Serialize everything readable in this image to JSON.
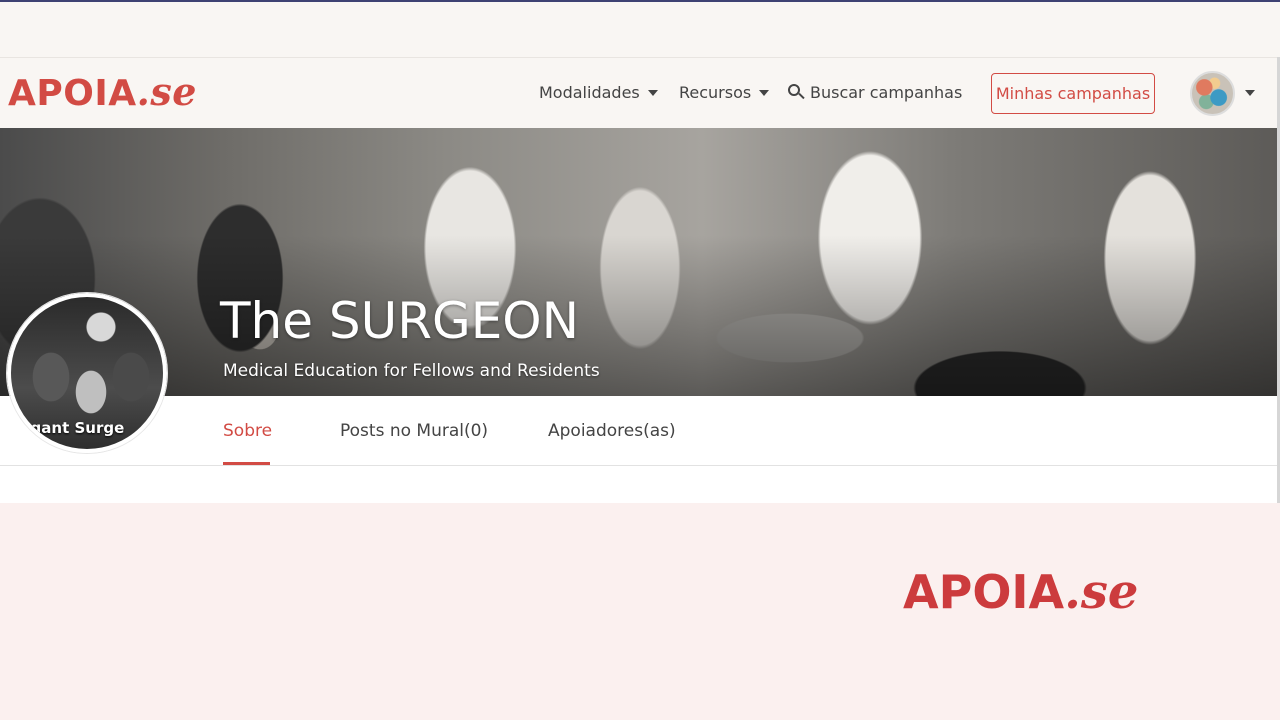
{
  "brand": {
    "logo_main": "APOIA",
    "logo_suffix": ".se",
    "color": "#d24b44"
  },
  "nav": {
    "modalities": "Modalidades",
    "resources": "Recursos",
    "search": "Buscar campanhas",
    "my_campaigns": "Minhas campanhas"
  },
  "campaign": {
    "title": "The SURGEON",
    "subtitle": "Medical Education for Fellows and Residents",
    "profile_image_text": "Elegant Surge"
  },
  "tabs": [
    {
      "label": "Sobre",
      "active": true
    },
    {
      "label": "Posts no Mural(0)",
      "active": false
    },
    {
      "label": "Apoiadores(as)",
      "active": false
    }
  ],
  "footer": {
    "logo_main": "APOIA",
    "logo_suffix": ".se"
  }
}
